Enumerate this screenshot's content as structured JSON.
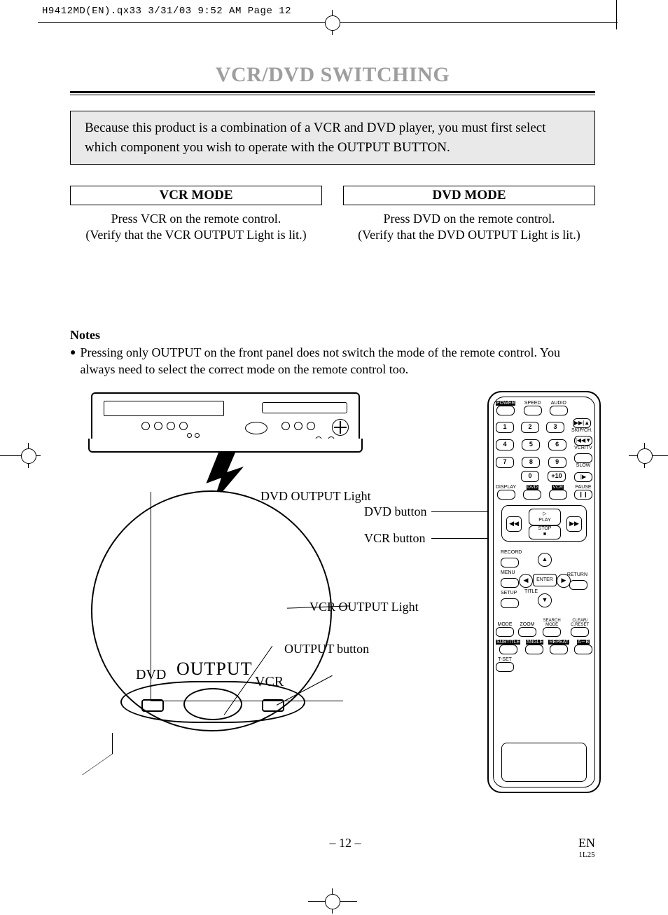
{
  "crop_header": "H9412MD(EN).qx33  3/31/03 9:52 AM  Page 12",
  "title": "VCR/DVD SWITCHING",
  "intro": "Because this product is a combination of a VCR and DVD player, you must first select which component you wish to operate with the OUTPUT BUTTON.",
  "vcr_mode": {
    "head": "VCR MODE",
    "line1": "Press VCR on the remote control.",
    "line2": "(Verify that the VCR OUTPUT Light is lit.)"
  },
  "dvd_mode": {
    "head": "DVD MODE",
    "line1": "Press DVD on the remote control.",
    "line2": "(Verify that the DVD OUTPUT Light is lit.)"
  },
  "notes": {
    "head": "Notes",
    "item1": "Pressing only OUTPUT on the front panel does not switch the mode of the remote control. You always need to select the correct mode on the remote control too."
  },
  "zoom": {
    "output": "OUTPUT",
    "dvd": "DVD",
    "vcr": "VCR"
  },
  "callouts": {
    "dvd_light": "DVD OUTPUT Light",
    "vcr_light": "VCR OUTPUT Light",
    "output_btn": "OUTPUT button",
    "dvd_btn": "DVD button",
    "vcr_btn": "VCR button"
  },
  "remote": {
    "row1": {
      "power": "POWER",
      "speed": "SPEED",
      "audio": "AUDIO"
    },
    "nums": [
      "1",
      "2",
      "3",
      "4",
      "5",
      "6",
      "7",
      "8",
      "9",
      "0",
      "+10"
    ],
    "skipch": "SKIP/CH.",
    "vcrtv": "VCR/TV",
    "slow": "SLOW",
    "display": "DISPLAY",
    "dvd": "DVD",
    "vcr": "VCR",
    "pause": "PAUSE",
    "play": "PLAY",
    "stop": "STOP",
    "record": "RECORD",
    "menu": "MENU",
    "setup": "SETUP",
    "title": "TITLE",
    "enter": "ENTER",
    "return": "RETURN",
    "mode": "MODE",
    "zoom": "ZOOM",
    "search": "SEARCH MODE",
    "clear": "CLEAR/ C.RESET",
    "subtitle": "SUBTITLE",
    "angle": "ANGLE",
    "repeat": "REPEAT",
    "ab": "A－B",
    "tset": "T-SET",
    "sym_skip_fwd": "▶▶|▲",
    "sym_skip_back": "|◀◀▼",
    "sym_slow": "|▶",
    "sym_pause": "❙❙",
    "sym_rew": "◀◀",
    "sym_ff": "▶▶",
    "sym_play": "▷",
    "sym_stop": "■",
    "sym_up": "▲",
    "sym_down": "▼",
    "sym_left": "◀",
    "sym_right": "▶"
  },
  "footer": {
    "page": "– 12 –",
    "lang": "EN",
    "code": "1L25"
  }
}
